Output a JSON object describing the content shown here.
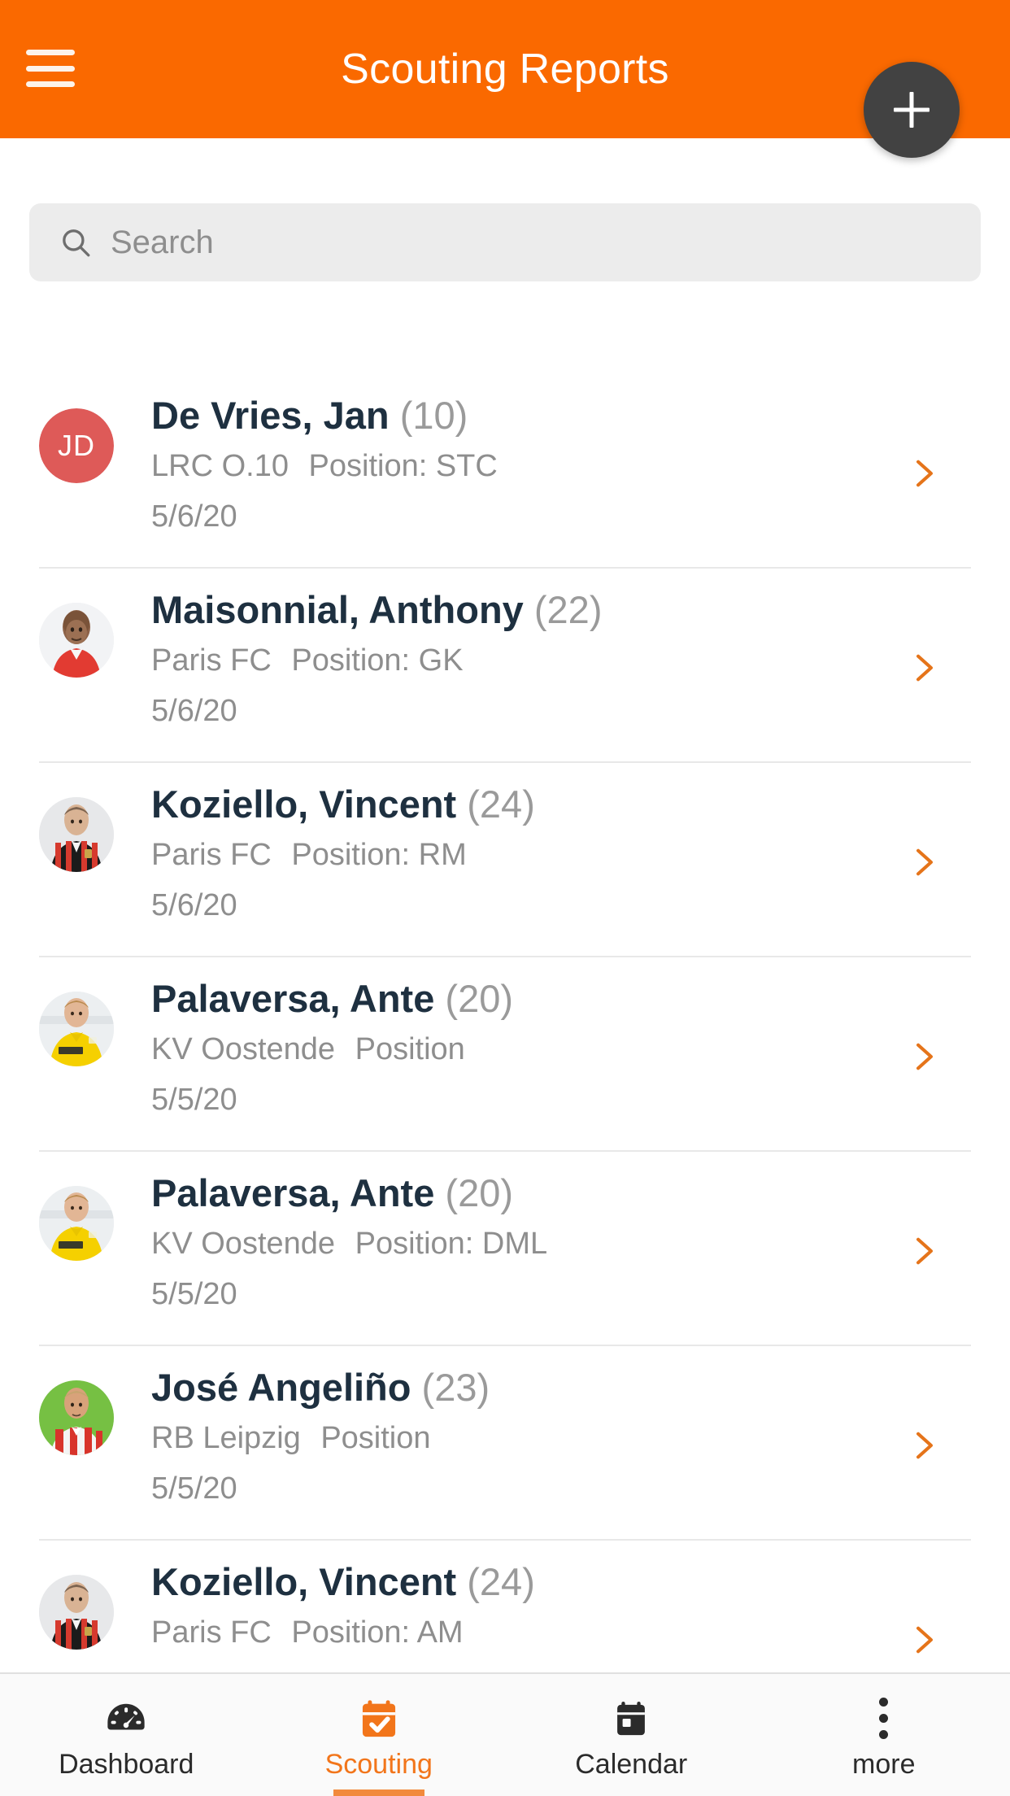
{
  "theme": {
    "appbar_color": "#fa6900",
    "accent_color": "#f2751a",
    "fab_color": "#424242",
    "chevron_color": "#e5741a",
    "search_bg": "#ececec",
    "name_color": "#1e3040",
    "muted_text": "#8e8e8e"
  },
  "appbar": {
    "title": "Scouting Reports",
    "menu_icon": "hamburger-menu-icon",
    "fab_icon": "plus-icon",
    "fab_label": "+"
  },
  "search": {
    "placeholder": "Search",
    "value": "",
    "icon": "search-icon"
  },
  "list": {
    "chevron_icon": "chevron-right-icon",
    "rows": [
      {
        "name": "De Vries, Jan",
        "age": "(10)",
        "club": "LRC O.10",
        "position_label": "Position: STC",
        "date": "5/6/20",
        "avatar_type": "initials",
        "avatar_initials": "JD",
        "avatar_color": "#de5a58"
      },
      {
        "name": "Maisonnial, Anthony",
        "age": "(22)",
        "club": "Paris FC",
        "position_label": "Position: GK",
        "date": "5/6/20",
        "avatar_type": "photo",
        "avatar_kit": "red-shirt-bald-player-photo",
        "avatar_color": "#e23b32"
      },
      {
        "name": "Koziello, Vincent",
        "age": "(24)",
        "club": "Paris FC",
        "position_label": "Position: RM",
        "date": "5/6/20",
        "avatar_type": "photo",
        "avatar_kit": "red-black-striped-shirt-player-photo",
        "avatar_color": "#d63a2e"
      },
      {
        "name": "Palaversa, Ante",
        "age": "(20)",
        "club": "KV Oostende",
        "position_label": "Position",
        "date": "5/5/20",
        "avatar_type": "photo",
        "avatar_kit": "yellow-diaz-shirt-player-photo",
        "avatar_color": "#f5d000"
      },
      {
        "name": "Palaversa, Ante",
        "age": "(20)",
        "club": "KV Oostende",
        "position_label": "Position: DML",
        "date": "5/5/20",
        "avatar_type": "photo",
        "avatar_kit": "yellow-diaz-shirt-player-photo",
        "avatar_color": "#f5d000"
      },
      {
        "name": "José Angeliño",
        "age": "(23)",
        "club": "RB Leipzig",
        "position_label": "Position",
        "date": "5/5/20",
        "avatar_type": "photo",
        "avatar_kit": "green-background-red-white-shirt-player-photo",
        "avatar_color": "#76c043"
      },
      {
        "name": "Koziello, Vincent",
        "age": "(24)",
        "club": "Paris FC",
        "position_label": "Position: AM",
        "date": "",
        "avatar_type": "photo",
        "avatar_kit": "red-black-striped-shirt-player-photo",
        "avatar_color": "#d63a2e"
      }
    ]
  },
  "bottom_nav": {
    "items": [
      {
        "label": "Dashboard",
        "icon": "speedometer-icon",
        "active": false
      },
      {
        "label": "Scouting",
        "icon": "calendar-check-icon",
        "active": true
      },
      {
        "label": "Calendar",
        "icon": "calendar-icon",
        "active": false
      },
      {
        "label": "more",
        "icon": "three-dots-vertical-icon",
        "active": false
      }
    ]
  }
}
